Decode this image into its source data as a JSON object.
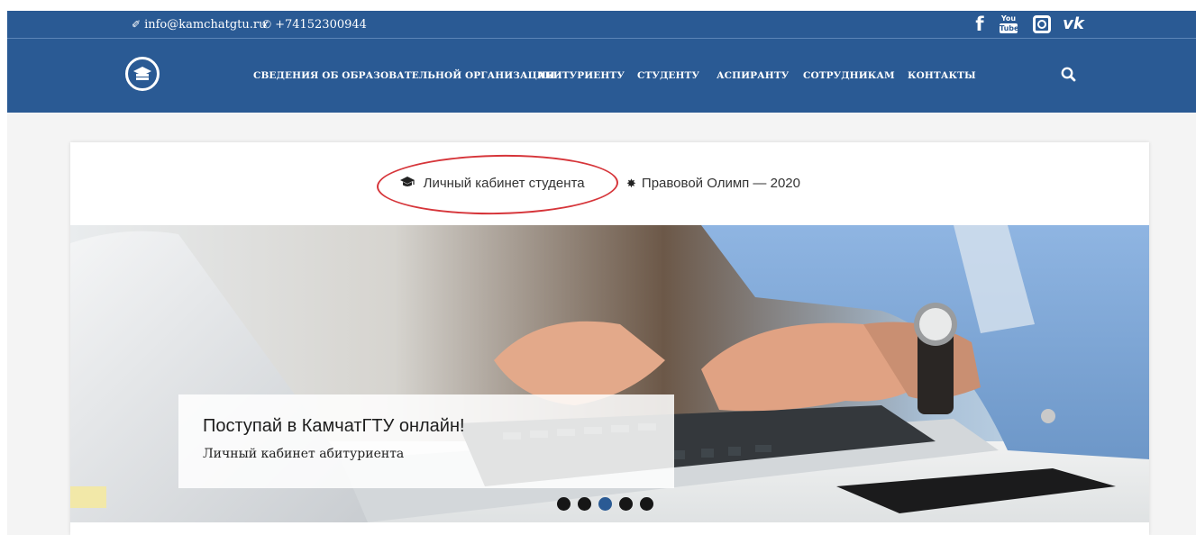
{
  "topbar": {
    "email": "info@kamchatgtu.ru",
    "phone": "+74152300944",
    "email_icon": "pencil-icon",
    "phone_icon": "phone-icon",
    "socials": [
      {
        "name": "facebook-icon",
        "glyph": "f"
      },
      {
        "name": "youtube-icon",
        "top": "You",
        "bottom": "Tube"
      },
      {
        "name": "instagram-icon"
      },
      {
        "name": "vk-icon",
        "glyph": "vk"
      }
    ]
  },
  "nav": {
    "items": [
      {
        "label": "СВЕДЕНИЯ ОБ ОБРАЗОВАТЕЛЬНОЙ ОРГАНИЗАЦИИ"
      },
      {
        "label": "АБИТУРИЕНТУ"
      },
      {
        "label": "СТУДЕНТУ"
      },
      {
        "label": "АСПИРАНТУ"
      },
      {
        "label": "СОТРУДНИКАМ"
      },
      {
        "label": "КОНТАКТЫ"
      }
    ],
    "search_icon": "search-icon",
    "logo_icon": "graduation-cap-logo-icon"
  },
  "quicklinks": [
    {
      "label": "Личный кабинет студента",
      "icon": "graduation-cap-icon",
      "glyph": "🎓"
    },
    {
      "label": "Правовой Олимп — 2020",
      "icon": "asterisk-icon",
      "glyph": "✸"
    }
  ],
  "slider": {
    "caption_title": "Поступай в КамчатГТУ онлайн!",
    "caption_link": "Личный кабинет абитуриента",
    "slide_count": 5,
    "active_slide": 3
  },
  "colors": {
    "brand": "#2a5a94",
    "annotation": "#d6353a",
    "dot": "#161616"
  }
}
